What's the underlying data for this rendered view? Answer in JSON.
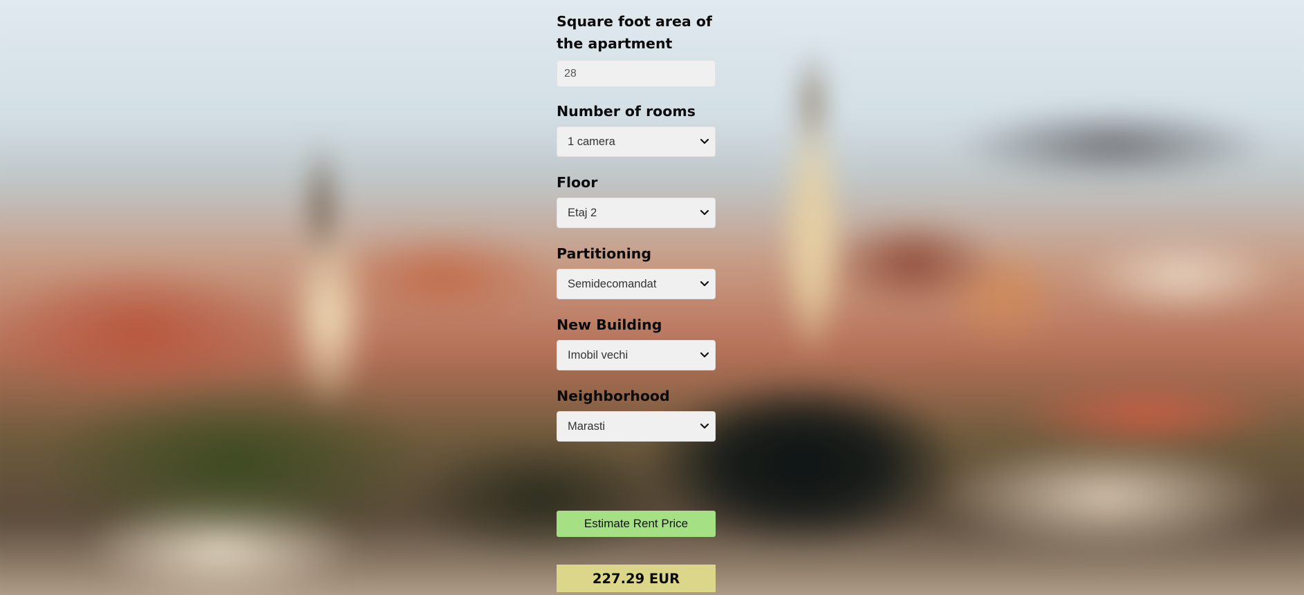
{
  "form": {
    "area": {
      "label": "Square foot area of the apartment",
      "value": "28"
    },
    "rooms": {
      "label": "Number of rooms",
      "selected": "1 camera"
    },
    "floor": {
      "label": "Floor",
      "selected": "Etaj 2"
    },
    "partitioning": {
      "label": "Partitioning",
      "selected": "Semidecomandat"
    },
    "new_building": {
      "label": "New Building",
      "selected": "Imobil vechi"
    },
    "neighborhood": {
      "label": "Neighborhood",
      "selected": "Marasti"
    },
    "submit_label": "Estimate Rent Price"
  },
  "result": {
    "text": "227.29 EUR"
  },
  "colors": {
    "button": "#a6e085",
    "result_bg": "#dcd68a",
    "field_bg": "#f0f0f0"
  },
  "icons": [
    "chevron-down-icon"
  ]
}
